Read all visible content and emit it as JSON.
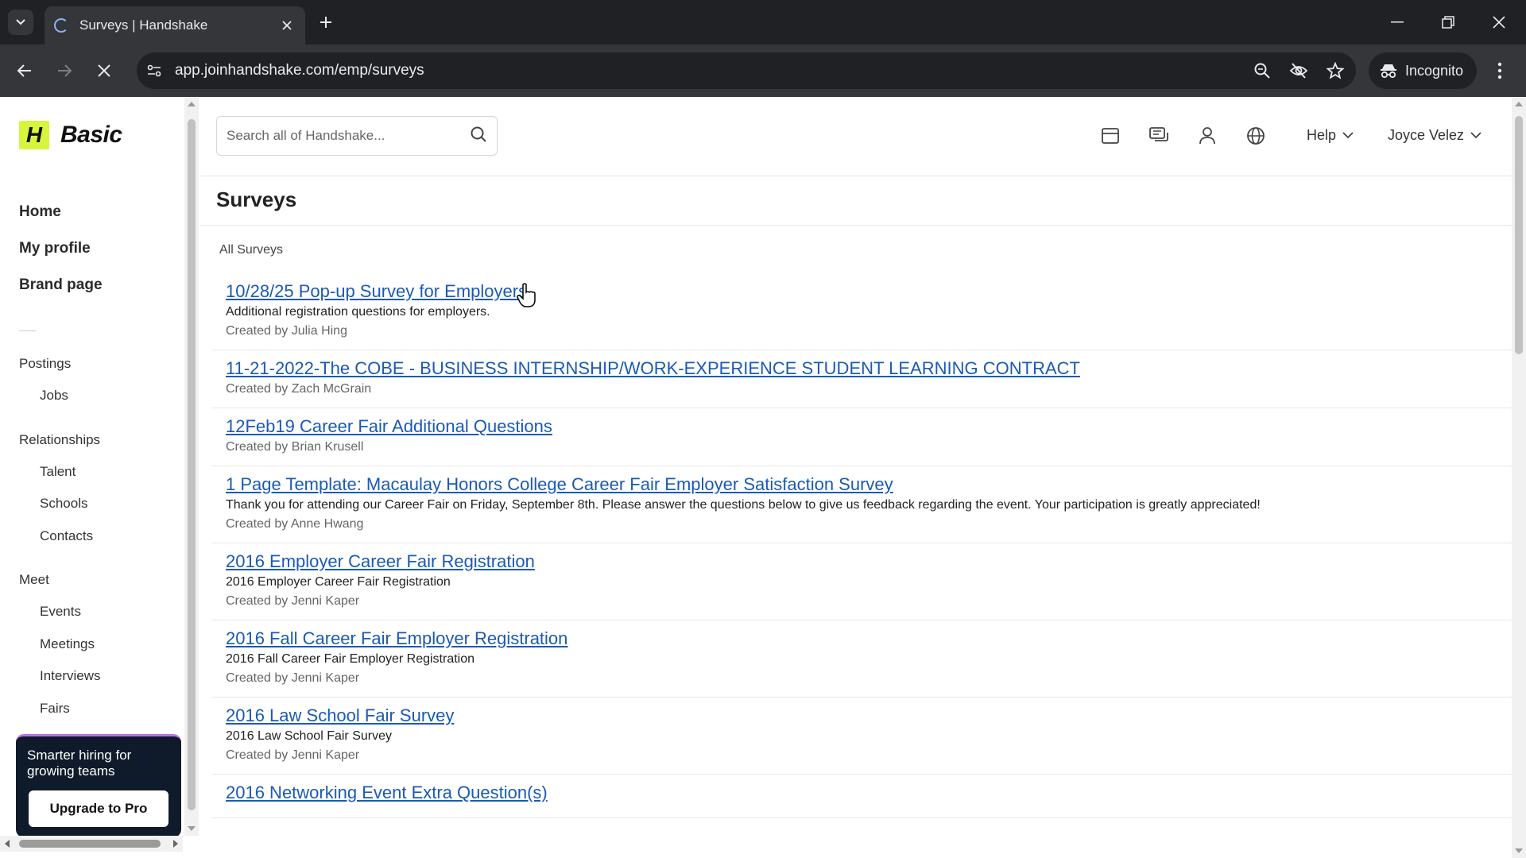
{
  "browser": {
    "tab_title": "Surveys | Handshake",
    "url": "app.joinhandshake.com/emp/surveys",
    "incognito_label": "Incognito"
  },
  "sidebar": {
    "logo_mark": "H",
    "logo_text": "Basic",
    "main_links": [
      "Home",
      "My profile",
      "Brand page"
    ],
    "groups": {
      "postings": {
        "label": "Postings",
        "items": [
          "Jobs"
        ]
      },
      "relationships": {
        "label": "Relationships",
        "items": [
          "Talent",
          "Schools",
          "Contacts"
        ]
      },
      "meet": {
        "label": "Meet",
        "items": [
          "Events",
          "Meetings",
          "Interviews",
          "Fairs"
        ]
      }
    },
    "promo": {
      "text": "Smarter hiring for growing teams",
      "button": "Upgrade to Pro"
    }
  },
  "topbar": {
    "search_placeholder": "Search all of Handshake...",
    "help_label": "Help",
    "user_name": "Joyce Velez"
  },
  "page": {
    "title": "Surveys",
    "section_label": "All Surveys"
  },
  "surveys": [
    {
      "title": "10/28/25 Pop-up Survey for Employers",
      "description": "Additional registration questions for employers.",
      "created_by": "Created by Julia Hing"
    },
    {
      "title": "11-21-2022-The COBE - BUSINESS INTERNSHIP/WORK-EXPERIENCE STUDENT LEARNING CONTRACT",
      "description": "",
      "created_by": "Created by Zach McGrain"
    },
    {
      "title": "12Feb19 Career Fair Additional Questions",
      "description": "",
      "created_by": "Created by Brian Krusell"
    },
    {
      "title": "1 Page Template: Macaulay Honors College Career Fair Employer Satisfaction Survey",
      "description": "Thank you for attending our Career Fair on Friday, September 8th. Please answer the questions below to give us feedback regarding the event. Your participation is greatly appreciated!",
      "created_by": "Created by Anne Hwang"
    },
    {
      "title": "2016 Employer Career Fair Registration",
      "description": "2016 Employer Career Fair Registration",
      "created_by": "Created by Jenni Kaper"
    },
    {
      "title": "2016 Fall Career Fair Employer Registration",
      "description": "2016 Fall Career Fair Employer Registration",
      "created_by": "Created by Jenni Kaper"
    },
    {
      "title": "2016 Law School Fair Survey",
      "description": "2016 Law School Fair Survey",
      "created_by": "Created by Jenni Kaper"
    },
    {
      "title": "2016 Networking Event Extra Question(s)",
      "description": "",
      "created_by": ""
    }
  ],
  "colors": {
    "link": "#1a5ab5",
    "brand_accent": "#d7f53c",
    "promo_bg": "#0f1b2a",
    "chrome_dark": "#202124"
  }
}
